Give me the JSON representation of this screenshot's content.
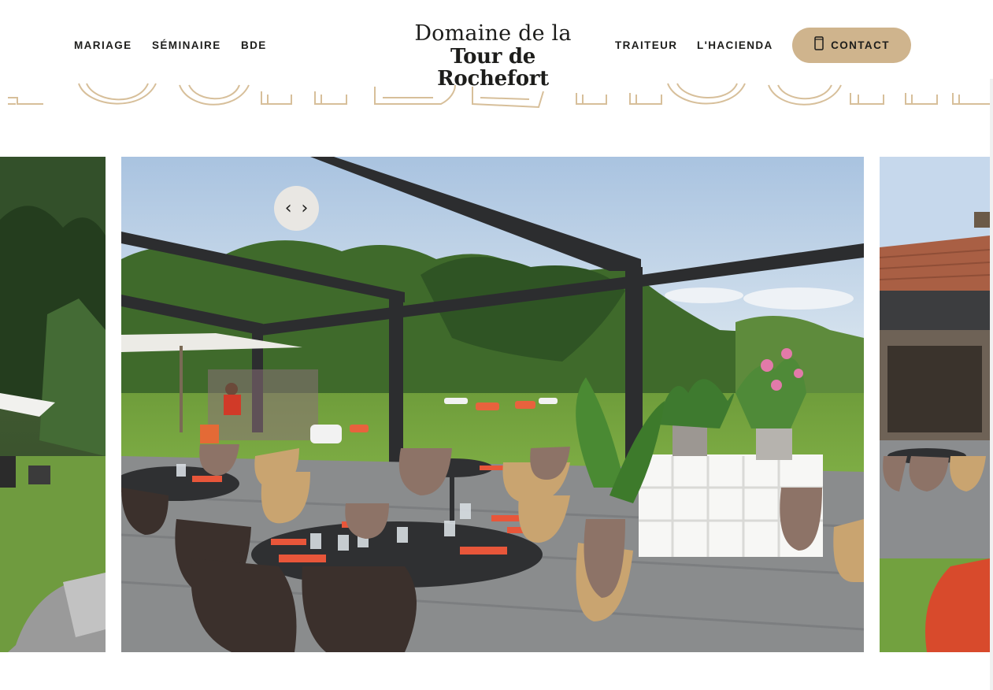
{
  "nav": {
    "left": [
      "MARIAGE",
      "SÉMINAIRE",
      "BDE"
    ],
    "right": [
      "TRAITEUR",
      "L'HACIENDA"
    ]
  },
  "logo": {
    "line1": "Domaine de la",
    "line2": "Tour de Rochefort"
  },
  "contact_button": {
    "label": "CONTACT",
    "icon": "phone-icon"
  },
  "slider": {
    "prev_icon": "chevron-left-icon",
    "next_icon": "chevron-right-icon",
    "prev_glyph": "‹",
    "next_glyph": "›"
  },
  "colors": {
    "accent": "#cfb48d",
    "text": "#1d1d1b",
    "arrow_bg": "#e9e7e3"
  }
}
